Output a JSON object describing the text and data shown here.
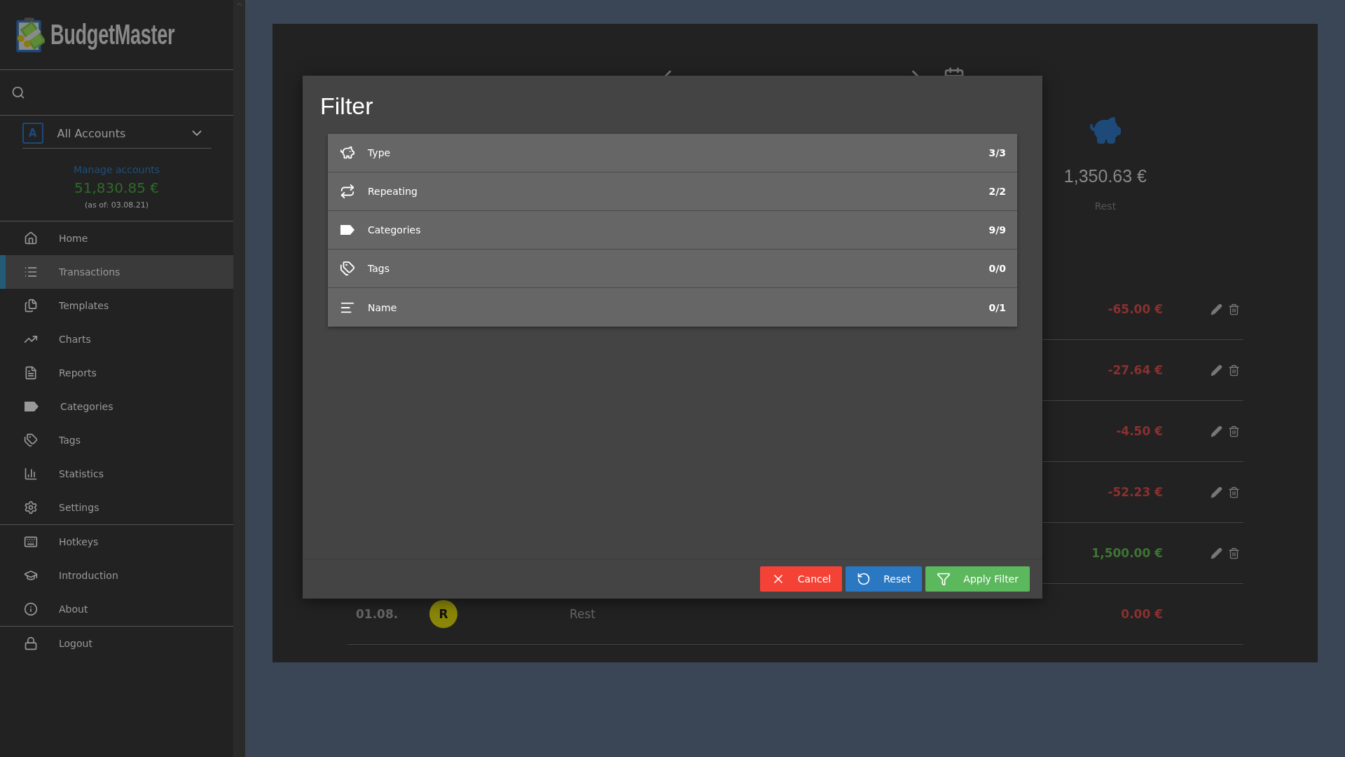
{
  "sidebar": {
    "brand": "BudgetMaster",
    "account": {
      "badge": "A",
      "name": "All Accounts"
    },
    "manage_link": "Manage accounts",
    "balance": "51,830.85 €",
    "as_of": "(as of: 03.08.21)",
    "nav_groups": [
      {
        "items": [
          {
            "label": "Home",
            "selected": false
          },
          {
            "label": "Transactions",
            "selected": true
          },
          {
            "label": "Templates",
            "selected": false
          },
          {
            "label": "Charts",
            "selected": false
          },
          {
            "label": "Reports",
            "selected": false
          },
          {
            "label": "Categories",
            "selected": false
          },
          {
            "label": "Tags",
            "selected": false
          },
          {
            "label": "Statistics",
            "selected": false
          },
          {
            "label": "Settings",
            "selected": false
          }
        ]
      },
      {
        "items": [
          {
            "label": "Hotkeys",
            "selected": false
          },
          {
            "label": "Introduction",
            "selected": false
          },
          {
            "label": "About",
            "selected": false
          }
        ]
      },
      {
        "items": [
          {
            "label": "Logout",
            "selected": false
          }
        ]
      }
    ]
  },
  "summary": {
    "amount": "1,350.63 €",
    "label": "Rest"
  },
  "transactions": [
    {
      "amount": "-65.00 €",
      "color": "#8b3030",
      "actions": true
    },
    {
      "amount": "-27.64 €",
      "color": "#8b3030",
      "actions": true
    },
    {
      "amount": "-4.50 €",
      "color": "#8b3030",
      "actions": true
    },
    {
      "amount": "-52.23 €",
      "color": "#8b3030",
      "actions": true
    },
    {
      "amount": "1,500.00 €",
      "color": "#3e7435",
      "actions": true
    },
    {
      "date": "01.08.",
      "category": {
        "letter": "R",
        "color": "#8a8608"
      },
      "name": "Rest",
      "amount": "0.00 €",
      "color": "#8b3030",
      "actions": false
    }
  ],
  "filter_dialog": {
    "title": "Filter",
    "rows": [
      {
        "label": "Type",
        "count": "3/3"
      },
      {
        "label": "Repeating",
        "count": "2/2"
      },
      {
        "label": "Categories",
        "count": "9/9"
      },
      {
        "label": "Tags",
        "count": "0/0"
      },
      {
        "label": "Name",
        "count": "0/1"
      }
    ],
    "buttons": [
      {
        "kind": "cancel",
        "label": "Cancel"
      },
      {
        "kind": "reset",
        "label": "Reset"
      },
      {
        "kind": "apply",
        "label": "Apply Filter"
      }
    ]
  }
}
